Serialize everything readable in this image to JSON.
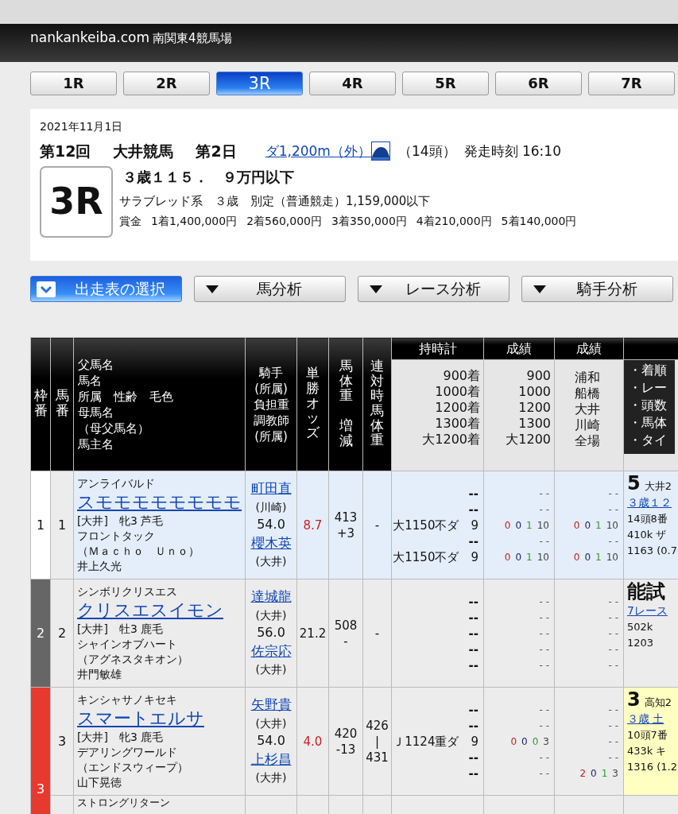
{
  "site": {
    "brand": "nankankeiba.com",
    "subtitle": "南関東4競馬場"
  },
  "race_tabs": [
    {
      "label": "1R",
      "selected": false
    },
    {
      "label": "2R",
      "selected": false
    },
    {
      "label": "3R",
      "selected": true
    },
    {
      "label": "4R",
      "selected": false
    },
    {
      "label": "5R",
      "selected": false
    },
    {
      "label": "6R",
      "selected": false
    },
    {
      "label": "7R",
      "selected": false
    }
  ],
  "race": {
    "date": "2021年11月1日",
    "meeting": "第12回",
    "venue": "大井競馬",
    "day": "第2日",
    "course": "ダ1,200m（外）",
    "runners": "（14頭）",
    "post_time": "発走時刻 16:10",
    "number": "3R",
    "name": "３歳１１５．　９万円以下",
    "conditions": "サラブレッド系　３歳　別定（普通競走）1,159,000以下",
    "prize_label": "賞金",
    "prizes": [
      "1着1,400,000円",
      "2着560,000円",
      "3着350,000円",
      "4着210,000円",
      "5着140,000円"
    ]
  },
  "menu": [
    {
      "label": "出走表の選択",
      "selected": true
    },
    {
      "label": "馬分析",
      "selected": false
    },
    {
      "label": "レース分析",
      "selected": false
    },
    {
      "label": "騎手分析",
      "selected": false
    }
  ],
  "table": {
    "columns": [
      {
        "kind": "vertical",
        "lines": [
          "枠番"
        ]
      },
      {
        "kind": "vertical",
        "lines": [
          "馬番"
        ]
      },
      {
        "kind": "stack",
        "lines": [
          "父馬名",
          "馬名",
          "所属　性齢　毛色",
          "母馬名",
          "（母父馬名）",
          "馬主名"
        ]
      },
      {
        "kind": "center",
        "lines": [
          "騎手",
          "(所属)",
          "負担重",
          "調教師",
          "(所属)"
        ]
      },
      {
        "kind": "vertical",
        "lines": [
          "単勝オッズ"
        ]
      },
      {
        "kind": "vertical",
        "lines": [
          "馬体重",
          "増減"
        ]
      },
      {
        "kind": "vertical",
        "lines": [
          "連対時馬体重"
        ]
      },
      {
        "kind": "group",
        "label": "持時計",
        "lines": [
          "900着",
          "1000着",
          "1200着",
          "1300着",
          "大1200着"
        ]
      },
      {
        "kind": "group",
        "label": "成績",
        "lines": [
          "900",
          "1000",
          "1200",
          "1300",
          "大1200"
        ]
      },
      {
        "kind": "group_center",
        "label": "成績",
        "lines": [
          "浦和",
          "船橋",
          "大井",
          "川崎",
          "全場"
        ]
      },
      {
        "kind": "group_dark",
        "lines": [
          "・着順",
          "・レー",
          "・頭数",
          "・馬体",
          "・タイ"
        ]
      }
    ],
    "rows": [
      {
        "frame": {
          "number": "1",
          "color": "#ffffff"
        },
        "number": "1",
        "highlighted": true,
        "sire": "アンライバルド",
        "name": "スモモモモモモモモ",
        "profile": "[大井]　牝3 芦毛",
        "dam": "フロントタック",
        "damsire": "（Ｍａｃｈｏ　Ｕｎｏ）",
        "owner": "井上久光",
        "jockey": "町田直",
        "jockey_affiliation": "(川崎)",
        "load": "54.0",
        "trainer": "櫻木英",
        "trainer_affiliation": "(大井)",
        "odds": "8.7",
        "odds_hot": true,
        "body_weight": "413",
        "body_weight_change": "+3",
        "best_weight": [
          "-"
        ],
        "times": [
          {
            "kind": "dash",
            "text": "--"
          },
          {
            "kind": "dash",
            "text": "--"
          },
          {
            "kind": "time",
            "text": "大1150不ダ　9"
          },
          {
            "kind": "dash",
            "text": "--"
          },
          {
            "kind": "time",
            "text": "大1150不ダ　9"
          }
        ],
        "distance_records": [
          {
            "kind": "dash",
            "text": "- -"
          },
          {
            "kind": "dash",
            "text": "- -"
          },
          {
            "kind": "record",
            "values": [
              "0",
              "0",
              "1",
              "10"
            ]
          },
          {
            "kind": "dash",
            "text": "- -"
          },
          {
            "kind": "record",
            "values": [
              "0",
              "0",
              "1",
              "10"
            ]
          }
        ],
        "venue_records": [
          {
            "kind": "dash",
            "text": "- -"
          },
          {
            "kind": "dash",
            "text": "- -"
          },
          {
            "kind": "record",
            "values": [
              "0",
              "0",
              "1",
              "10"
            ]
          },
          {
            "kind": "dash",
            "text": "- -"
          },
          {
            "kind": "record",
            "values": [
              "0",
              "0",
              "1",
              "10"
            ]
          }
        ],
        "last_race": {
          "rank": "5",
          "place": "大井2",
          "race": "３歳１２",
          "lines": [
            "14頭8番",
            "410k ザ",
            "1163 (0.7"
          ],
          "highlighted": false
        }
      },
      {
        "frame": {
          "number": "2",
          "color": "#666666"
        },
        "number": "2",
        "highlighted": false,
        "sire": "シンボリクリスエス",
        "name": "クリスエスイモン",
        "profile": "[大井]　牡3 鹿毛",
        "dam": "シャインオブハート",
        "damsire": "（アグネスタキオン）",
        "owner": "井門敏雄",
        "jockey": "達城龍",
        "jockey_affiliation": "(大井)",
        "load": "56.0",
        "trainer": "佐宗応",
        "trainer_affiliation": "(大井)",
        "odds": "21.2",
        "odds_hot": false,
        "body_weight": "508",
        "body_weight_change": "-",
        "best_weight": [
          "-"
        ],
        "times": [
          {
            "kind": "dash",
            "text": "--"
          },
          {
            "kind": "dash",
            "text": "--"
          },
          {
            "kind": "dash",
            "text": "--"
          },
          {
            "kind": "dash",
            "text": "--"
          },
          {
            "kind": "dash",
            "text": "--"
          }
        ],
        "distance_records": [
          {
            "kind": "dash",
            "text": "- -"
          },
          {
            "kind": "dash",
            "text": "- -"
          },
          {
            "kind": "dash",
            "text": "- -"
          },
          {
            "kind": "dash",
            "text": "- -"
          },
          {
            "kind": "dash",
            "text": "- -"
          }
        ],
        "venue_records": [
          {
            "kind": "dash",
            "text": "- -"
          },
          {
            "kind": "dash",
            "text": "- -"
          },
          {
            "kind": "dash",
            "text": "- -"
          },
          {
            "kind": "dash",
            "text": "- -"
          },
          {
            "kind": "dash",
            "text": "- -"
          }
        ],
        "last_race": {
          "rank": "能試",
          "race": "7レース",
          "lines": [
            "502k",
            "1203"
          ],
          "highlighted": false
        }
      },
      {
        "frame": {
          "number": "3",
          "color": "#e8392f"
        },
        "number": "3",
        "highlighted": false,
        "sire": "キンシャサノキセキ",
        "name": "スマートエルサ",
        "profile": "[大井]　牝3 鹿毛",
        "dam": "デアリングワールド",
        "damsire": "（エンドスウィープ）",
        "owner": "山下晃徳",
        "jockey": "矢野貴",
        "jockey_affiliation": "(大井)",
        "load": "54.0",
        "trainer": "上杉昌",
        "trainer_affiliation": "(大井)",
        "odds": "4.0",
        "odds_hot": true,
        "body_weight": "420",
        "body_weight_change": "-13",
        "best_weight": [
          "426",
          "|",
          "431"
        ],
        "times": [
          {
            "kind": "dash",
            "text": "--"
          },
          {
            "kind": "dash",
            "text": "--"
          },
          {
            "kind": "time",
            "text": "Ｊ1124重ダ　9"
          },
          {
            "kind": "dash",
            "text": "--"
          },
          {
            "kind": "dash",
            "text": "--"
          }
        ],
        "distance_records": [
          {
            "kind": "dash",
            "text": "- -"
          },
          {
            "kind": "dash",
            "text": "- -"
          },
          {
            "kind": "record",
            "values": [
              "0",
              "0",
              "0",
              "3"
            ]
          },
          {
            "kind": "dash",
            "text": "- -"
          },
          {
            "kind": "dash",
            "text": "- -"
          }
        ],
        "venue_records": [
          {
            "kind": "dash",
            "text": "- -"
          },
          {
            "kind": "dash",
            "text": "- -"
          },
          {
            "kind": "dash",
            "text": "- -"
          },
          {
            "kind": "dash",
            "text": "- -"
          },
          {
            "kind": "record",
            "values": [
              "2",
              "0",
              "1",
              "3"
            ]
          }
        ],
        "last_race": {
          "rank": "3",
          "place": "高知2",
          "race": "３歳 土",
          "lines": [
            "10頭7番",
            "433k キ",
            "1316 (1.2"
          ],
          "highlighted": true
        }
      },
      {
        "highlighted": false,
        "sire": "ストロングリターン"
      }
    ]
  }
}
